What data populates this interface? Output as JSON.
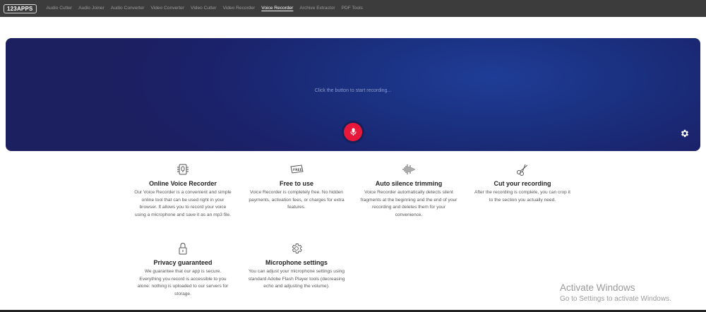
{
  "header": {
    "logo": "123APPS",
    "nav": [
      {
        "label": "Audio Cutter",
        "active": false
      },
      {
        "label": "Audio Joiner",
        "active": false
      },
      {
        "label": "Audio Converter",
        "active": false
      },
      {
        "label": "Video Converter",
        "active": false
      },
      {
        "label": "Video Cutter",
        "active": false
      },
      {
        "label": "Video Recorder",
        "active": false
      },
      {
        "label": "Voice Recorder",
        "active": true
      },
      {
        "label": "Archive Extractor",
        "active": false
      },
      {
        "label": "PDF Tools",
        "active": false
      }
    ]
  },
  "recorder": {
    "hint": "Click the button to start recording...",
    "record_icon": "microphone-icon",
    "settings_icon": "gear-icon",
    "accent": "#e8183a"
  },
  "features": [
    {
      "icon": "microphone-chip-icon",
      "title": "Online Voice Recorder",
      "desc": "Our Voice Recorder is a convenient and simple online tool that can be used right in your browser. It allows you to record your voice using a microphone and save it as an mp3 file."
    },
    {
      "icon": "free-tag-icon",
      "title": "Free to use",
      "desc": "Voice Recorder is completely free. No hidden payments, activation fees, or charges for extra features."
    },
    {
      "icon": "waveform-icon",
      "title": "Auto silence trimming",
      "desc": "Voice Recorder automatically detects silent fragments at the beginning and the end of your recording and deletes them for your convenience."
    },
    {
      "icon": "scissors-icon",
      "title": "Cut your recording",
      "desc": "After the recording is complete, you can crop it to the section you actually need."
    },
    {
      "icon": "lock-icon",
      "title": "Privacy guaranteed",
      "desc": "We guarantee that our app is secure. Everything you record is accessible to you alone: nothing is uploaded to our servers for storage."
    },
    {
      "icon": "gear-icon",
      "title": "Microphone settings",
      "desc": "You can adjust your microphone settings using standard Adobe Flash Player tools (decreasing echo and adjusting the volume)."
    }
  ],
  "watermark": {
    "title": "Activate Windows",
    "subtitle": "Go to Settings to activate Windows."
  }
}
